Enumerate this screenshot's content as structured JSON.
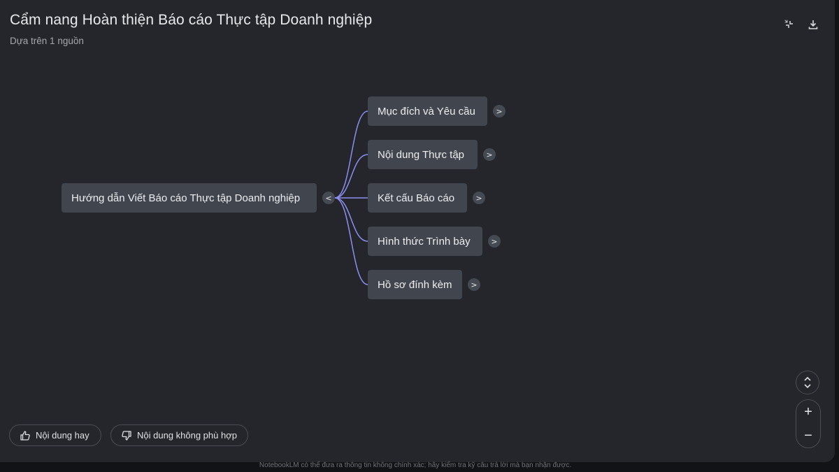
{
  "header": {
    "title": "Cẩm nang Hoàn thiện Báo cáo Thực tập Doanh nghiệp",
    "subtitle": "Dựa trên 1 nguồn",
    "collapse_icon": "collapse-icon",
    "download_icon": "download-icon"
  },
  "mindmap": {
    "root": {
      "label": "Hướng dẫn Viết Báo cáo Thực tập Doanh nghiệp",
      "toggle": "<"
    },
    "children": [
      {
        "label": "Mục đích và Yêu cầu",
        "toggle": ">"
      },
      {
        "label": "Nội dung Thực tập",
        "toggle": ">"
      },
      {
        "label": "Kết cấu Báo cáo",
        "toggle": ">"
      },
      {
        "label": "Hình thức Trình bày",
        "toggle": ">"
      },
      {
        "label": "Hồ sơ đính kèm",
        "toggle": ">"
      }
    ],
    "connector_color": "#8d8ef0"
  },
  "feedback": {
    "good_label": "Nội dung hay",
    "bad_label": "Nội dung không phù hợp",
    "good_icon": "thumbs-up-icon",
    "bad_icon": "thumbs-down-icon"
  },
  "zoom": {
    "fit_icon": "expand-vertical-icon",
    "in_label": "+",
    "out_label": "−"
  },
  "footer": {
    "disclaimer": "NotebookLM có thể đưa ra thông tin không chính xác; hãy kiểm tra kỹ câu trả lời mà bạn nhận được."
  }
}
